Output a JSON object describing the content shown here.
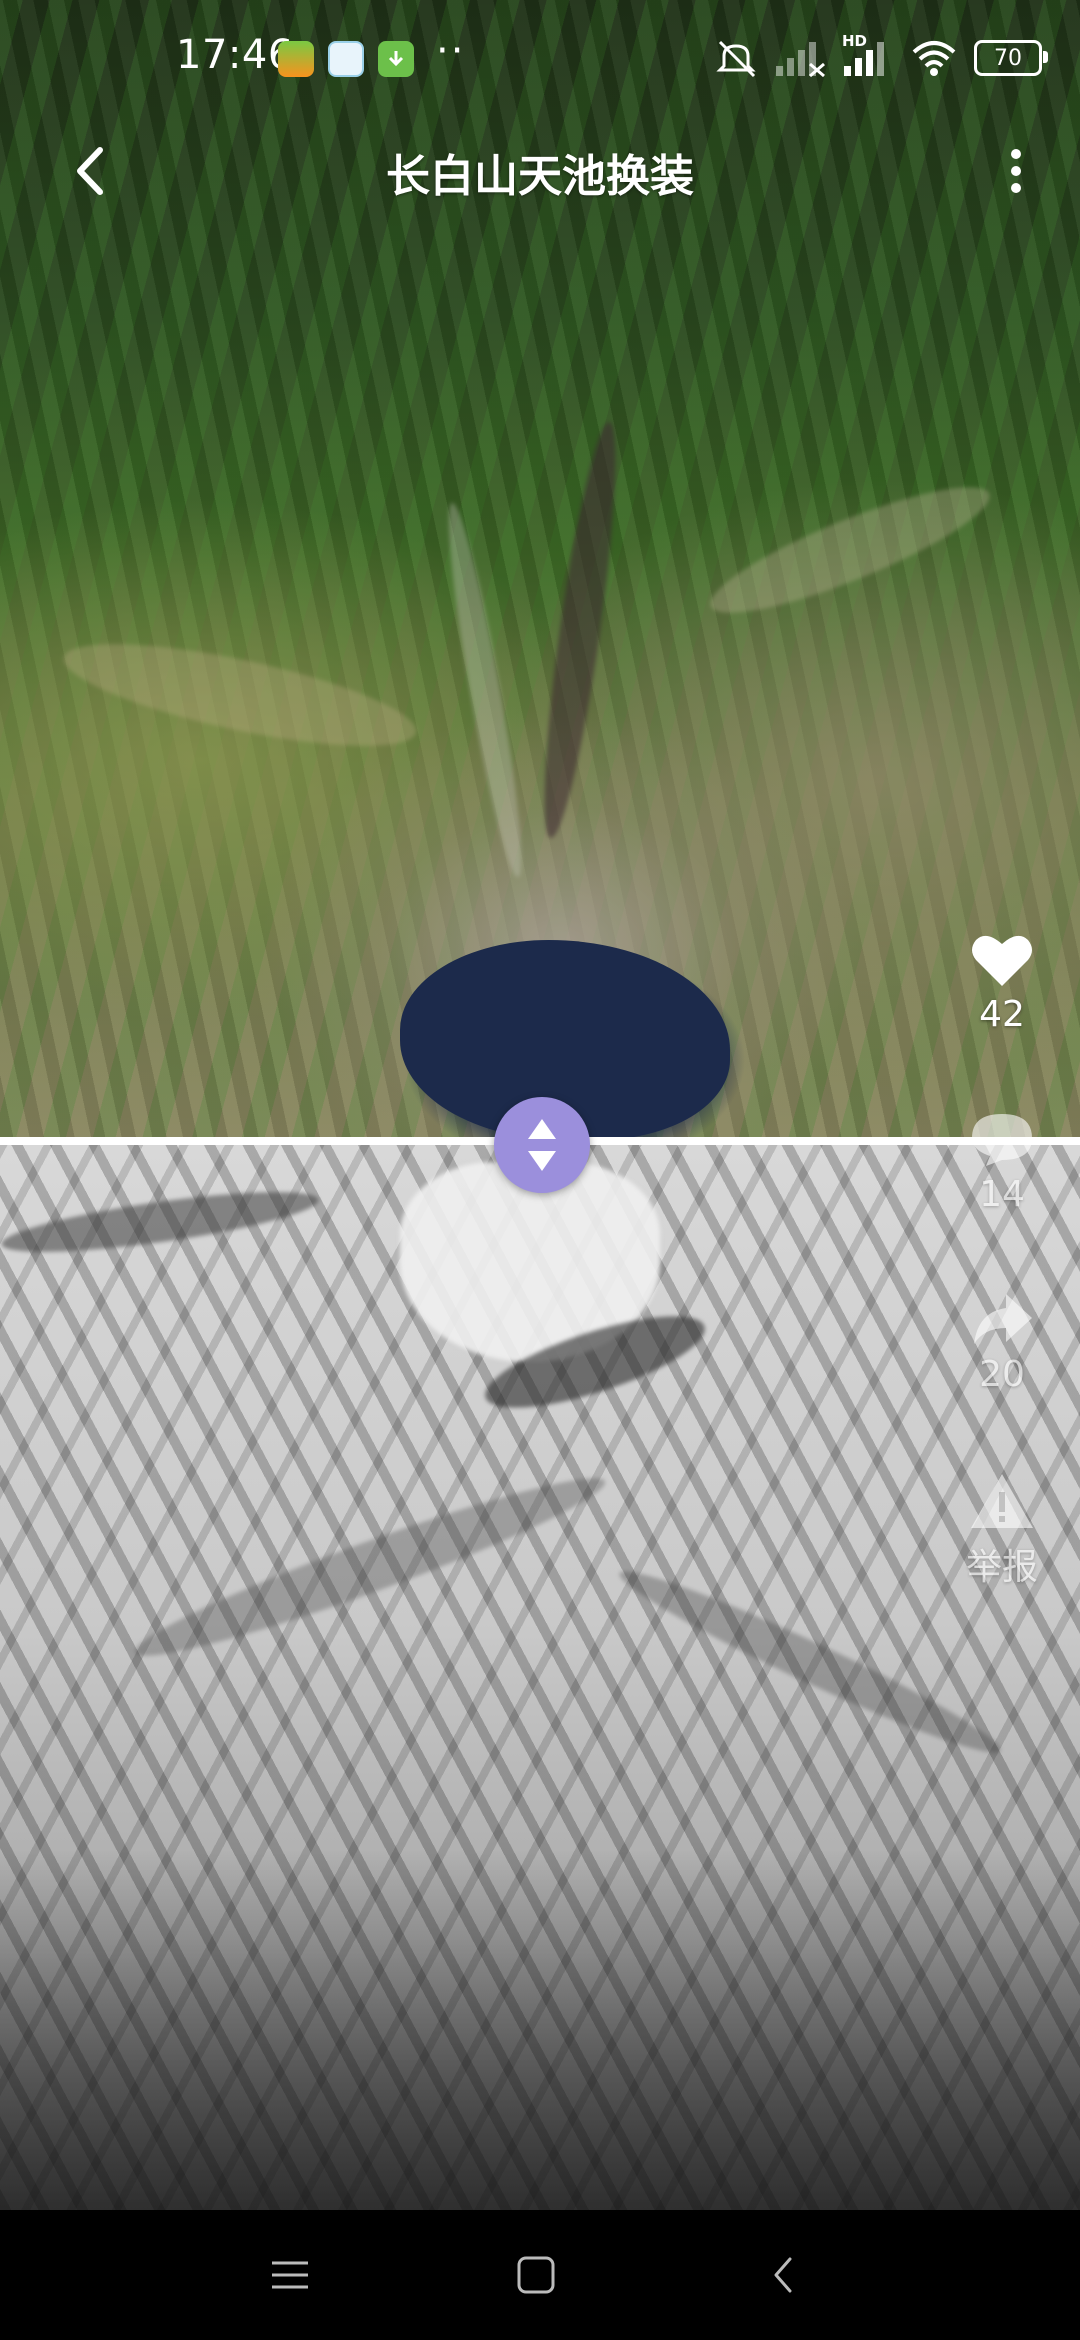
{
  "status_bar": {
    "time": "17:46",
    "app_icons": [
      "app-icon-1",
      "app-icon-2",
      "download-app-icon"
    ],
    "more_dots": "··",
    "network_label": "HD",
    "battery": "70",
    "icons": [
      "mute-icon",
      "signal-icon",
      "signal-hd-icon",
      "wifi-icon",
      "battery-icon"
    ]
  },
  "header": {
    "title": "长白山天池换装",
    "back_icon": "chevron-left-icon",
    "more_icon": "more-vertical-icon"
  },
  "actions": {
    "like": {
      "icon": "heart-icon",
      "count": "42"
    },
    "comment": {
      "icon": "comment-icon",
      "count": "14"
    },
    "share": {
      "icon": "share-icon",
      "count": "20"
    },
    "report": {
      "icon": "warning-icon",
      "label": "举报"
    }
  },
  "compare": {
    "handle_icon": "swap-vertical-icon",
    "handle_color": "#9b8fdc"
  },
  "nav_bar": {
    "icons": [
      "menu-icon",
      "home-square-icon",
      "back-chevron-icon"
    ]
  }
}
